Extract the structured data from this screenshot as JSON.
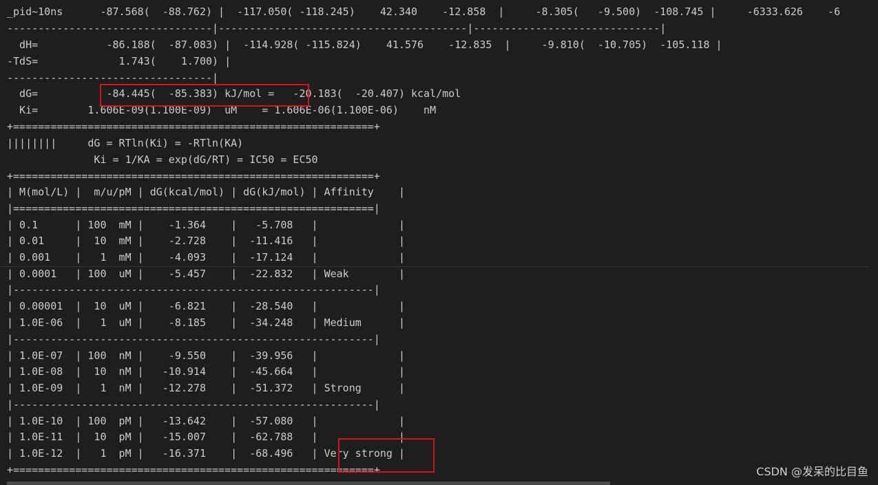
{
  "terminal": {
    "lines": [
      "_pid~10ns      -87.568(  -88.762) |  -117.050( -118.245)    42.340    -12.858  |     -8.305(   -9.500)  -108.745 |     -6333.626    -6",
      "---------------------------------|----------------------------------------|------------------------------|",
      "  dH=           -86.188(  -87.083) |  -114.928( -115.824)    41.576    -12.835  |     -9.810(  -10.705)  -105.118 |",
      "-TdS=             1.743(    1.700) |",
      "---------------------------------|",
      "  dG=           -84.445(  -85.383) kJ/mol =   -20.183(  -20.407) kcal/mol",
      "  Ki=        1.606E-09(1.100E-09)  uM    = 1.606E-06(1.100E-06)    nM",
      "+==========================================================+",
      "||||||||     dG = RTln(Ki) = -RTln(KA)",
      "              Ki = 1/KA = exp(dG/RT) = IC50 = EC50",
      "+==========================================================+",
      "| M(mol/L) |  m/u/pM | dG(kcal/mol) | dG(kJ/mol) | Affinity    |",
      "|==========================================================|",
      "| 0.1      | 100  mM |    -1.364    |   -5.708   |             |",
      "| 0.01     |  10  mM |    -2.728    |  -11.416   |             |",
      "| 0.001    |   1  mM |    -4.093    |  -17.124   |             |",
      "| 0.0001   | 100  uM |    -5.457    |  -22.832   | Weak        |",
      "|----------------------------------------------------------|",
      "| 0.00001  |  10  uM |    -6.821    |  -28.540   |             |",
      "| 1.0E-06  |   1  uM |    -8.185    |  -34.248   | Medium      |",
      "|----------------------------------------------------------|",
      "| 1.0E-07  | 100  nM |    -9.550    |  -39.956   |             |",
      "| 1.0E-08  |  10  nM |   -10.914    |  -45.664   |             |",
      "| 1.0E-09  |   1  nM |   -12.278    |  -51.372   | Strong      |",
      "|----------------------------------------------------------|",
      "| 1.0E-10  | 100  pM |   -13.642    |  -57.080   |             |",
      "| 1.0E-11  |  10  pM |   -15.007    |  -62.788   |             |",
      "| 1.0E-12  |   1  pM |   -16.371    |  -68.496   | Very strong |",
      "+==========================================================+"
    ]
  },
  "watermark": "CSDN @发呆的比目鱼"
}
